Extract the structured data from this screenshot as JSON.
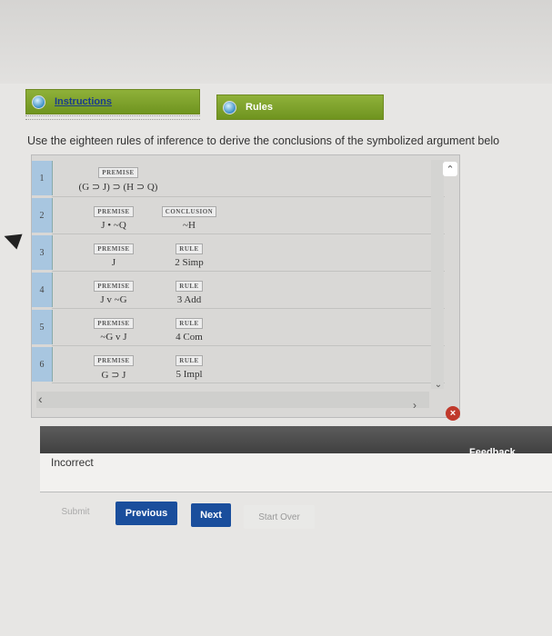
{
  "tabs": {
    "instructions": "Instructions",
    "rules": "Rules"
  },
  "instruction_text": "Use the eighteen rules of inference to derive the conclusions of the symbolized argument belo",
  "proof": {
    "rows": [
      {
        "num": "1",
        "left_tag": "PREMISE",
        "left_val": "(G ⊃ J) ⊃ (H ⊃ Q)",
        "right_tag": "",
        "right_val": ""
      },
      {
        "num": "2",
        "left_tag": "PREMISE",
        "left_val": "J • ~Q",
        "right_tag": "CONCLUSION",
        "right_val": "~H"
      },
      {
        "num": "3",
        "left_tag": "PREMISE",
        "left_val": "J",
        "right_tag": "RULE",
        "right_val": "2 Simp"
      },
      {
        "num": "4",
        "left_tag": "PREMISE",
        "left_val": "J v ~G",
        "right_tag": "RULE",
        "right_val": "3 Add"
      },
      {
        "num": "5",
        "left_tag": "PREMISE",
        "left_val": "~G v J",
        "right_tag": "RULE",
        "right_val": "4 Com"
      },
      {
        "num": "6",
        "left_tag": "PREMISE",
        "left_val": "G ⊃ J",
        "right_tag": "RULE",
        "right_val": "5 Impl"
      }
    ]
  },
  "feedback": {
    "label": "Feedback",
    "text": "Incorrect"
  },
  "buttons": {
    "submit": "Submit",
    "previous": "Previous",
    "next": "Next",
    "start_over": "Start Over"
  },
  "icons": {
    "close": "close-x-icon",
    "scroll_up": "chevron-up-icon",
    "scroll_down": "chevron-down-icon",
    "scroll_left": "chevron-left-icon",
    "scroll_right": "chevron-right-icon"
  },
  "colors": {
    "tab_green": "#7fa22d",
    "button_blue": "#1a4e9c",
    "row_number": "#a8c6e0"
  }
}
